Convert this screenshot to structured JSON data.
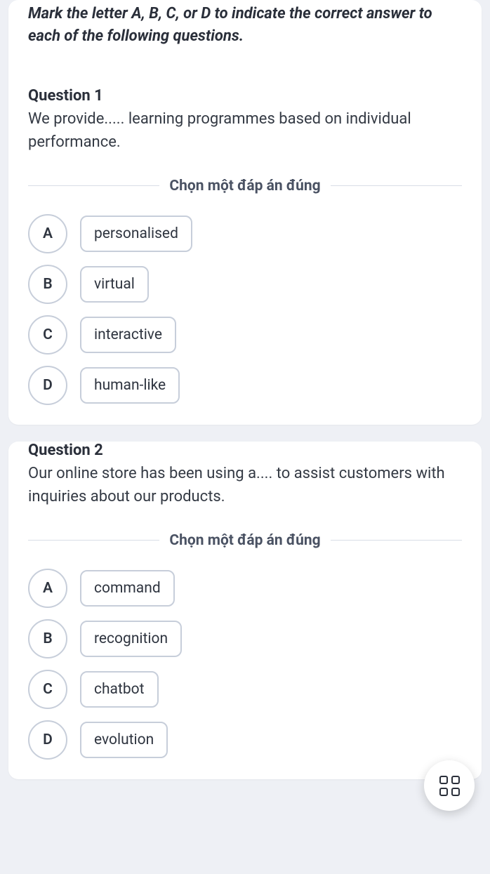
{
  "instruction": "Mark the letter A, B, C, or D to indicate the correct answer to each of the following questions.",
  "divider_label": "Chọn một đáp án đúng",
  "questions": [
    {
      "title": "Question 1",
      "text": "We provide..... learning programmes based on individual performance.",
      "options": [
        {
          "letter": "A",
          "text": "personalised"
        },
        {
          "letter": "B",
          "text": "virtual"
        },
        {
          "letter": "C",
          "text": "interactive"
        },
        {
          "letter": "D",
          "text": "human-like"
        }
      ]
    },
    {
      "title": "Question 2",
      "text": "Our online store has been using a....   to assist customers with inquiries about our products.",
      "options": [
        {
          "letter": "A",
          "text": "command"
        },
        {
          "letter": "B",
          "text": "recognition"
        },
        {
          "letter": "C",
          "text": "chatbot"
        },
        {
          "letter": "D",
          "text": "evolution"
        }
      ]
    }
  ],
  "fab": {
    "name": "grid-menu"
  }
}
